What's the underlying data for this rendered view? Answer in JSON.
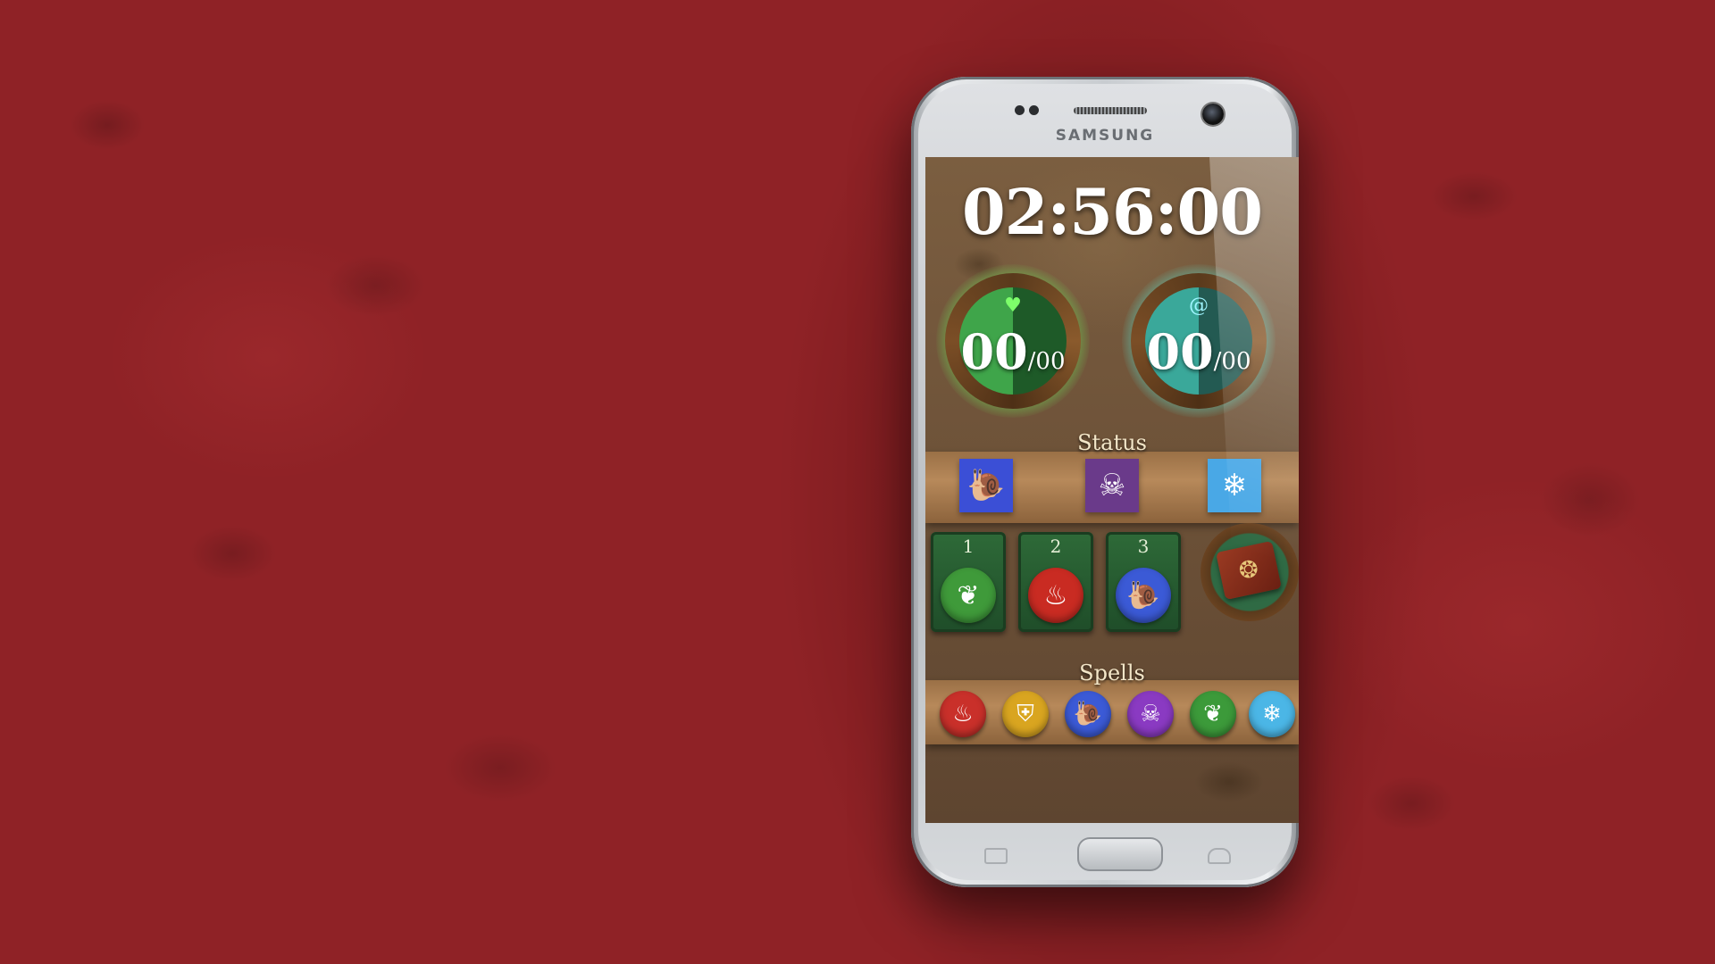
{
  "device": {
    "brand": "SAMSUNG"
  },
  "game": {
    "timer": "02:56:00",
    "health": {
      "icon": "heart-icon",
      "glyph": "♥",
      "current": "00",
      "max": "/00",
      "color": "#3fa54a"
    },
    "mana": {
      "icon": "spiral-icon",
      "glyph": "@",
      "current": "00",
      "max": "/00",
      "color": "#3aa89a"
    },
    "status": {
      "label": "Status",
      "effects": [
        {
          "name": "snail-icon",
          "glyph": "🐌",
          "bg": "#3b4fd6"
        },
        {
          "name": "skull-icon",
          "glyph": "☠",
          "bg": "#6a3a8a"
        },
        {
          "name": "snowflake-icon",
          "glyph": "❄",
          "bg": "#49a8e6"
        }
      ]
    },
    "slots": [
      {
        "number": "1",
        "icon": "leaf-icon",
        "glyph": "❦",
        "color": "#3f9a3a"
      },
      {
        "number": "2",
        "icon": "fire-icon",
        "glyph": "♨",
        "color": "#c92b22"
      },
      {
        "number": "3",
        "icon": "snail-icon",
        "glyph": "🐌",
        "color": "#3b5ad6"
      }
    ],
    "spellbook": {
      "icon": "spellbook-icon",
      "glyph": "❂"
    },
    "spells": {
      "label": "Spells",
      "items": [
        {
          "name": "fire-spell",
          "glyph": "♨",
          "color": "#c9302a"
        },
        {
          "name": "shield-spell",
          "glyph": "⛨",
          "color": "#d9a520"
        },
        {
          "name": "snail-spell",
          "glyph": "🐌",
          "color": "#3b5ad6"
        },
        {
          "name": "skull-spell",
          "glyph": "☠",
          "color": "#8a3ac2"
        },
        {
          "name": "leaf-spell",
          "glyph": "❦",
          "color": "#3c9a3a"
        },
        {
          "name": "ice-spell",
          "glyph": "❄",
          "color": "#4bb6e6"
        }
      ]
    }
  }
}
